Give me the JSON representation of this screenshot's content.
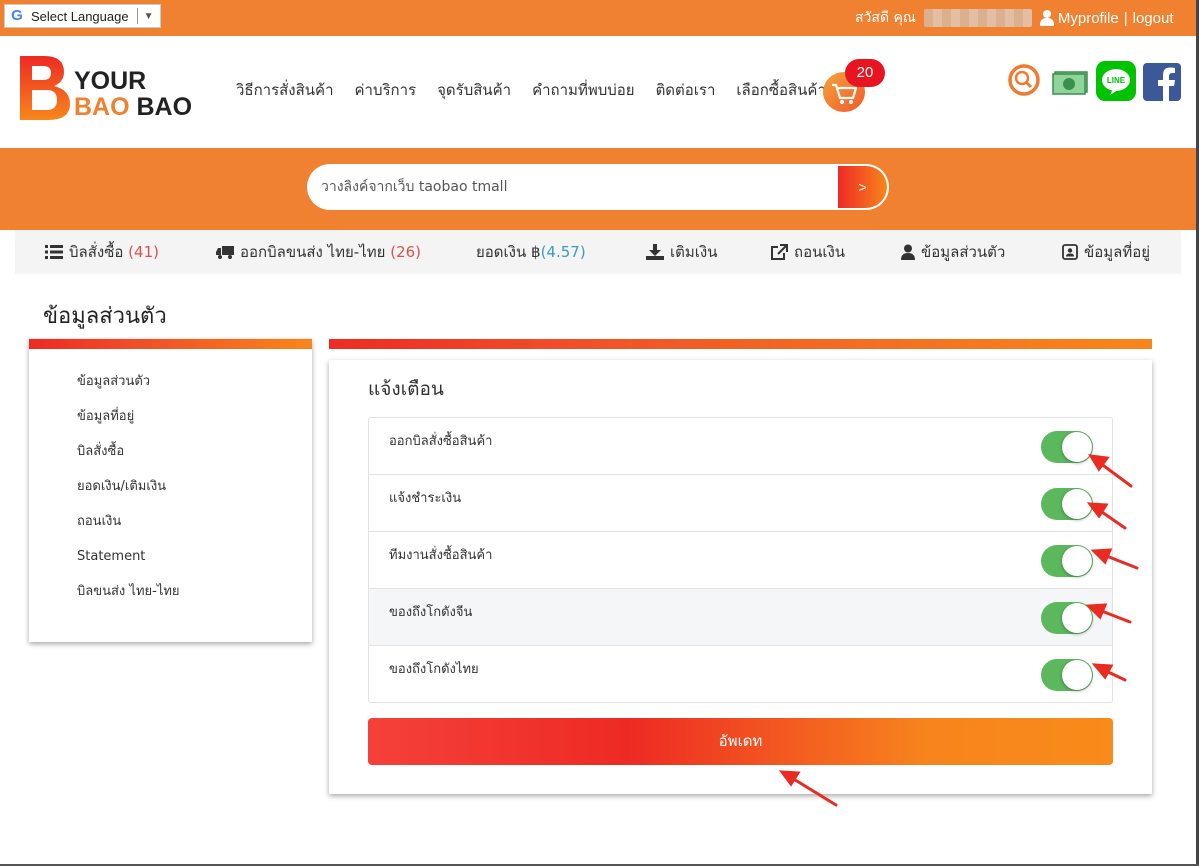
{
  "language_widget": {
    "label": "Select Language",
    "g": "G"
  },
  "topbar": {
    "greeting": "สวัสดี คุณ",
    "profile": "Myprofile",
    "divider": "|",
    "logout": "logout"
  },
  "logo": {
    "line1": "YOUR",
    "line2a": "BAO ",
    "line2b": "BAO"
  },
  "nav": [
    "วิธีการสั่งสินค้า",
    "ค่าบริการ",
    "จุดรับสินค้า",
    "คำถามที่พบบ่อย",
    "ติดต่อเรา",
    "เลือกซื้อสินค้า"
  ],
  "cart": {
    "count": "20"
  },
  "search": {
    "placeholder": "วางลิงค์จากเว็บ taobao tmall",
    "button": ">"
  },
  "subnav": {
    "orders_label": "บิลสั่งซื้อ",
    "orders_count": "(41)",
    "shipping_label": "ออกบิลขนส่ง ไทย-ไทย",
    "shipping_count": "(26)",
    "balance_label": "ยอดเงิน ฿",
    "balance_value": "(4.57)",
    "topup": "เติมเงิน",
    "withdraw": "ถอนเงิน",
    "profile": "ข้อมูลส่วนตัว",
    "address": "ข้อมูลที่อยู่"
  },
  "page_title": "ข้อมูลส่วนตัว",
  "sidebar": [
    "ข้อมูลส่วนตัว",
    "ข้อมูลที่อยู่",
    "บิลสั่งซื้อ",
    "ยอดเงิน/เติมเงิน",
    "ถอนเงิน",
    "Statement",
    "บิลขนส่ง ไทย-ไทย"
  ],
  "panel": {
    "title": "แจ้งเตือน",
    "toggles": [
      {
        "label": "ออกบิลสั่งซื้อสินค้า",
        "on": true
      },
      {
        "label": "แจ้งชำระเงิน",
        "on": true
      },
      {
        "label": "ทีมงานสั่งซื้อสินค้า",
        "on": true
      },
      {
        "label": "ของถึงโกดังจีน",
        "on": true
      },
      {
        "label": "ของถึงโกดังไทย",
        "on": true
      }
    ],
    "update_button": "อัพเดท"
  },
  "colors": {
    "brand_orange": "#ef8130",
    "toggle_green": "#5cb85c",
    "badge_red": "#e8141f",
    "annotation_red": "#ea2b22"
  }
}
